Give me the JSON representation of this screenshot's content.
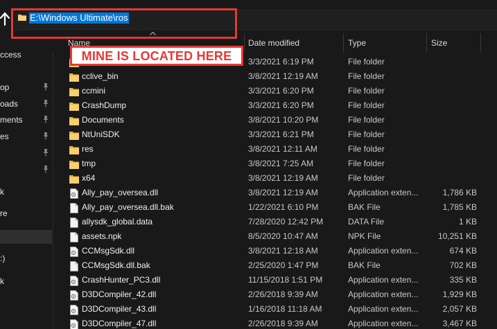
{
  "address_bar": {
    "path": "E:\\Windows Ultimate\\ros"
  },
  "annotation": {
    "label": "MINE IS LOCATED HERE",
    "color": "#e53935"
  },
  "nav_pane": {
    "items": [
      {
        "label": "ccess",
        "pinned": false
      },
      {
        "label": "op",
        "pinned": true
      },
      {
        "label": "oads",
        "pinned": true
      },
      {
        "label": "ments",
        "pinned": true
      },
      {
        "label": "es",
        "pinned": true
      },
      {
        "label": "",
        "pinned": true
      },
      {
        "label": "",
        "pinned": true
      },
      {
        "label": "k",
        "pinned": false
      },
      {
        "label": "re",
        "pinned": false
      },
      {
        "label": "",
        "pinned": false
      },
      {
        "label": ":)",
        "pinned": false
      },
      {
        "label": "",
        "pinned": false
      },
      {
        "label": "k",
        "pinned": false
      }
    ]
  },
  "columns": {
    "name": "Name",
    "date": "Date modified",
    "type": "Type",
    "size": "Size"
  },
  "files": [
    {
      "name": "",
      "date": "3/3/2021 6:19 PM",
      "type": "File folder",
      "size": "",
      "icon": "folder"
    },
    {
      "name": "cclive_bin",
      "date": "3/8/2021 12:19 AM",
      "type": "File folder",
      "size": "",
      "icon": "folder"
    },
    {
      "name": "ccmini",
      "date": "3/3/2021 6:20 PM",
      "type": "File folder",
      "size": "",
      "icon": "folder"
    },
    {
      "name": "CrashDump",
      "date": "3/3/2021 6:20 PM",
      "type": "File folder",
      "size": "",
      "icon": "folder"
    },
    {
      "name": "Documents",
      "date": "3/8/2021 10:20 PM",
      "type": "File folder",
      "size": "",
      "icon": "folder"
    },
    {
      "name": "NtUniSDK",
      "date": "3/3/2021 6:21 PM",
      "type": "File folder",
      "size": "",
      "icon": "folder"
    },
    {
      "name": "res",
      "date": "3/8/2021 12:11 AM",
      "type": "File folder",
      "size": "",
      "icon": "folder"
    },
    {
      "name": "tmp",
      "date": "3/8/2021 7:25 AM",
      "type": "File folder",
      "size": "",
      "icon": "folder"
    },
    {
      "name": "x64",
      "date": "3/8/2021 12:19 AM",
      "type": "File folder",
      "size": "",
      "icon": "folder"
    },
    {
      "name": "Ally_pay_oversea.dll",
      "date": "3/8/2021 12:19 AM",
      "type": "Application exten...",
      "size": "1,786 KB",
      "icon": "dll"
    },
    {
      "name": "Ally_pay_oversea.dll.bak",
      "date": "1/22/2021 6:10 PM",
      "type": "BAK File",
      "size": "1,785 KB",
      "icon": "doc"
    },
    {
      "name": "allysdk_global.data",
      "date": "7/28/2020 12:42 PM",
      "type": "DATA File",
      "size": "1 KB",
      "icon": "doc"
    },
    {
      "name": "assets.npk",
      "date": "8/5/2020 10:47 AM",
      "type": "NPK File",
      "size": "10,251 KB",
      "icon": "doc"
    },
    {
      "name": "CCMsgSdk.dll",
      "date": "3/8/2021 12:18 AM",
      "type": "Application exten...",
      "size": "674 KB",
      "icon": "dll"
    },
    {
      "name": "CCMsgSdk.dll.bak",
      "date": "2/25/2020 1:47 PM",
      "type": "BAK File",
      "size": "702 KB",
      "icon": "doc"
    },
    {
      "name": "CrashHunter_PC3.dll",
      "date": "11/15/2018 1:51 PM",
      "type": "Application exten...",
      "size": "335 KB",
      "icon": "dll"
    },
    {
      "name": "D3DCompiler_42.dll",
      "date": "2/26/2018 9:39 AM",
      "type": "Application exten...",
      "size": "1,929 KB",
      "icon": "dll"
    },
    {
      "name": "D3DCompiler_43.dll",
      "date": "1/16/2018 11:18 AM",
      "type": "Application exten...",
      "size": "2,057 KB",
      "icon": "dll"
    },
    {
      "name": "D3DCompiler_47.dll",
      "date": "2/26/2018 9:39 AM",
      "type": "Application exten...",
      "size": "3,467 KB",
      "icon": "dll"
    }
  ]
}
